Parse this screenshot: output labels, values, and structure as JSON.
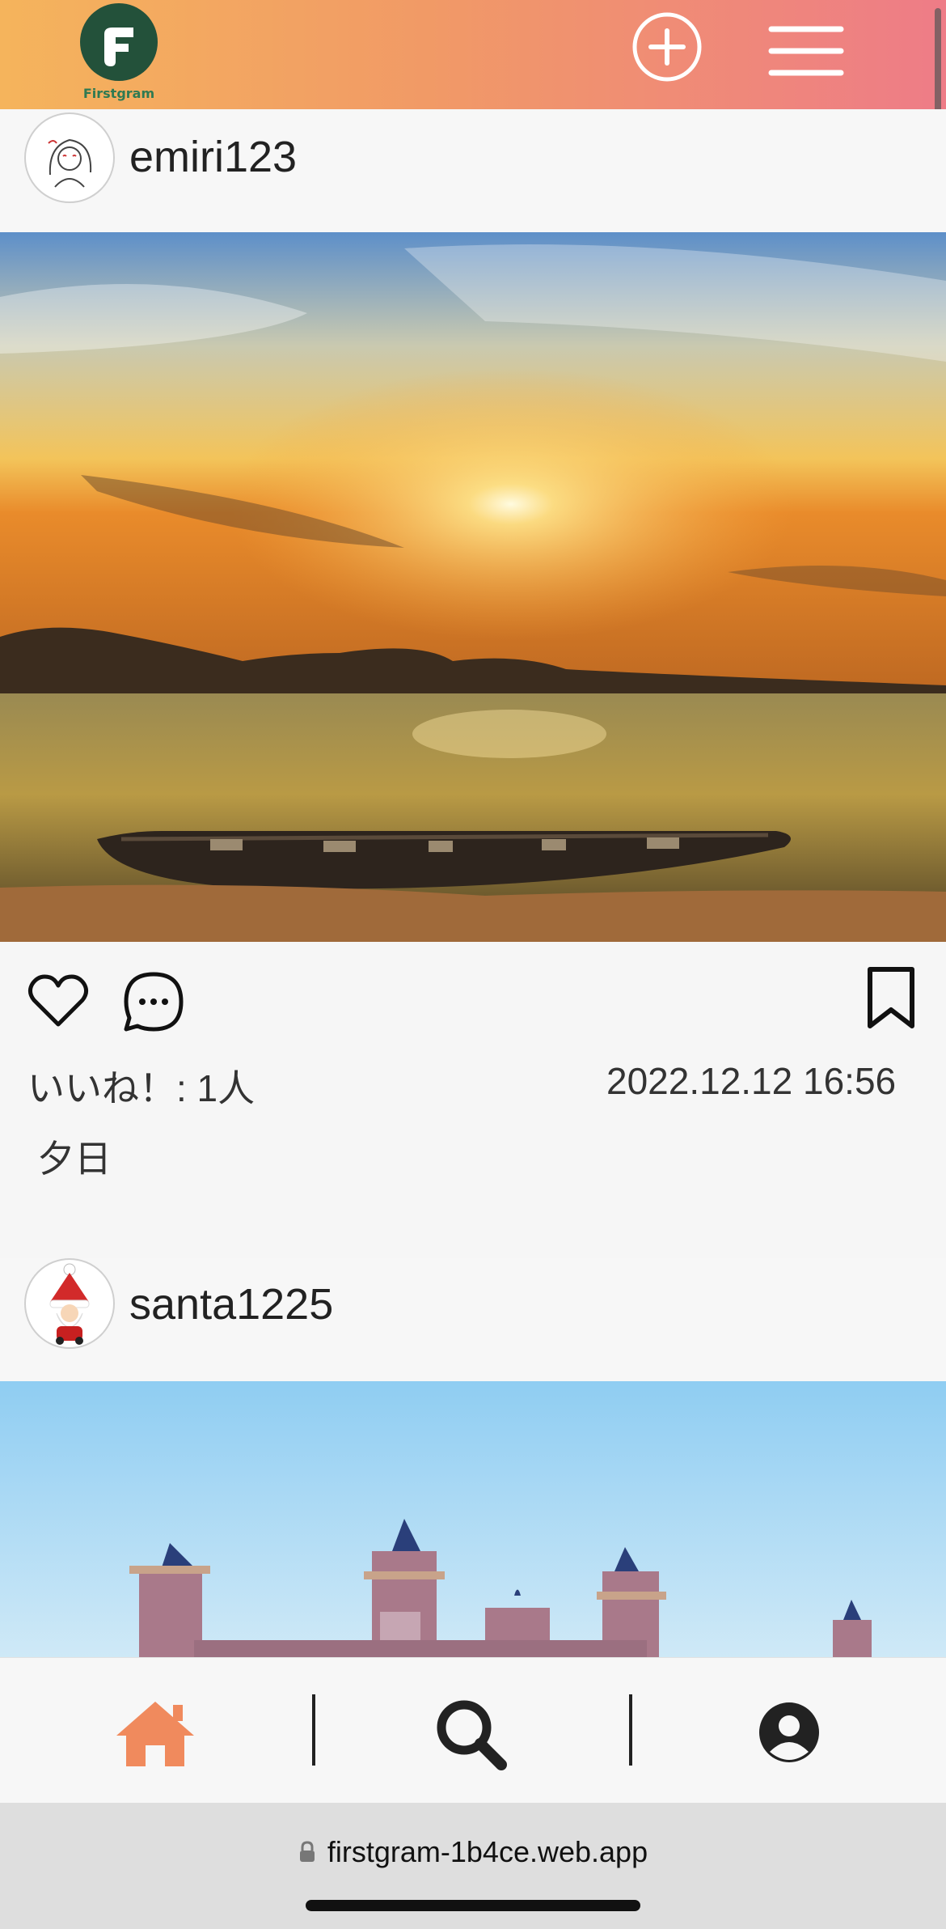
{
  "app": {
    "logo_text": "Firstgram",
    "brand_color": "#23513a",
    "accent_color": "#f08a5d"
  },
  "header": {
    "add_icon": "plus-circle-icon",
    "menu_icon": "hamburger-icon"
  },
  "posts": [
    {
      "username": "emiri123",
      "likes_label": "いいね！: 1人",
      "date": "2022.12.12 16:56",
      "caption": "夕日"
    },
    {
      "username": "santa1225"
    }
  ],
  "bottom_nav": {
    "items": [
      {
        "icon": "home-icon",
        "active": true,
        "color": "#f08a5d"
      },
      {
        "icon": "search-icon",
        "active": false
      },
      {
        "icon": "user-circle-icon",
        "active": false
      }
    ]
  },
  "browser": {
    "url": "firstgram-1b4ce.web.app",
    "lock_icon": "lock-icon"
  }
}
